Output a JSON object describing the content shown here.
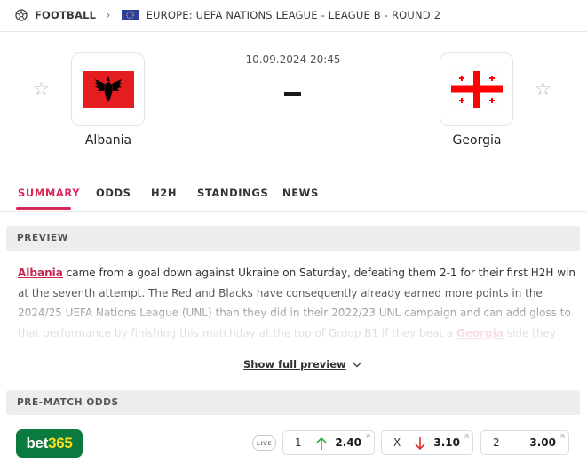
{
  "breadcrumb": {
    "sport": "FOOTBALL",
    "league": "EUROPE: UEFA NATIONS LEAGUE - LEAGUE B - ROUND 2"
  },
  "match": {
    "datetime": "10.09.2024 20:45",
    "score": "-",
    "home": {
      "name": "Albania",
      "flag_colors": {
        "field": "#e41e20",
        "eagle": "#000000"
      }
    },
    "away": {
      "name": "Georgia",
      "flag_colors": {
        "field": "#ffffff",
        "cross": "#ff0000"
      }
    }
  },
  "tabs": [
    {
      "label": "SUMMARY",
      "active": true
    },
    {
      "label": "ODDS",
      "active": false
    },
    {
      "label": "H2H",
      "active": false
    },
    {
      "label": "STANDINGS",
      "active": false
    },
    {
      "label": "NEWS",
      "active": false
    }
  ],
  "preview": {
    "header": "PREVIEW",
    "team_link_home": "Albania",
    "text_1": " came from a goal down against Ukraine on Saturday, defeating them 2-1 for their first H2H win at the seventh attempt. The Red and Blacks have consequently already earned more points in the 2024/25 UEFA Nations League (UNL) than they did in their 2022/23 UNL campaign and can add gloss to that performance by finishing this matchday at the top of Group B1 if they beat a ",
    "team_link_away": "Georgia",
    "text_2": " side they haven't defeated since June",
    "show_full": "Show full preview"
  },
  "odds": {
    "header": "PRE-MATCH ODDS",
    "bookmaker": {
      "name_a": "bet",
      "name_b": "365",
      "color": "#0a7a3f",
      "accent": "#ffdf1b"
    },
    "live_badge": "LIVE",
    "markets": [
      {
        "label": "1",
        "value": "2.40",
        "trend": "up",
        "trend_color": "#2cb24a"
      },
      {
        "label": "X",
        "value": "3.10",
        "trend": "down",
        "trend_color": "#e0302b"
      },
      {
        "label": "2",
        "value": "3.00",
        "trend": "none"
      }
    ]
  },
  "icons": {
    "sport": "football-icon",
    "breadcrumb_separator": "chevron-right-icon",
    "league_flag": "europe-flag-icon",
    "favorite": "star-outline-icon",
    "expand": "chevron-down-icon",
    "external": "external-link-icon"
  }
}
